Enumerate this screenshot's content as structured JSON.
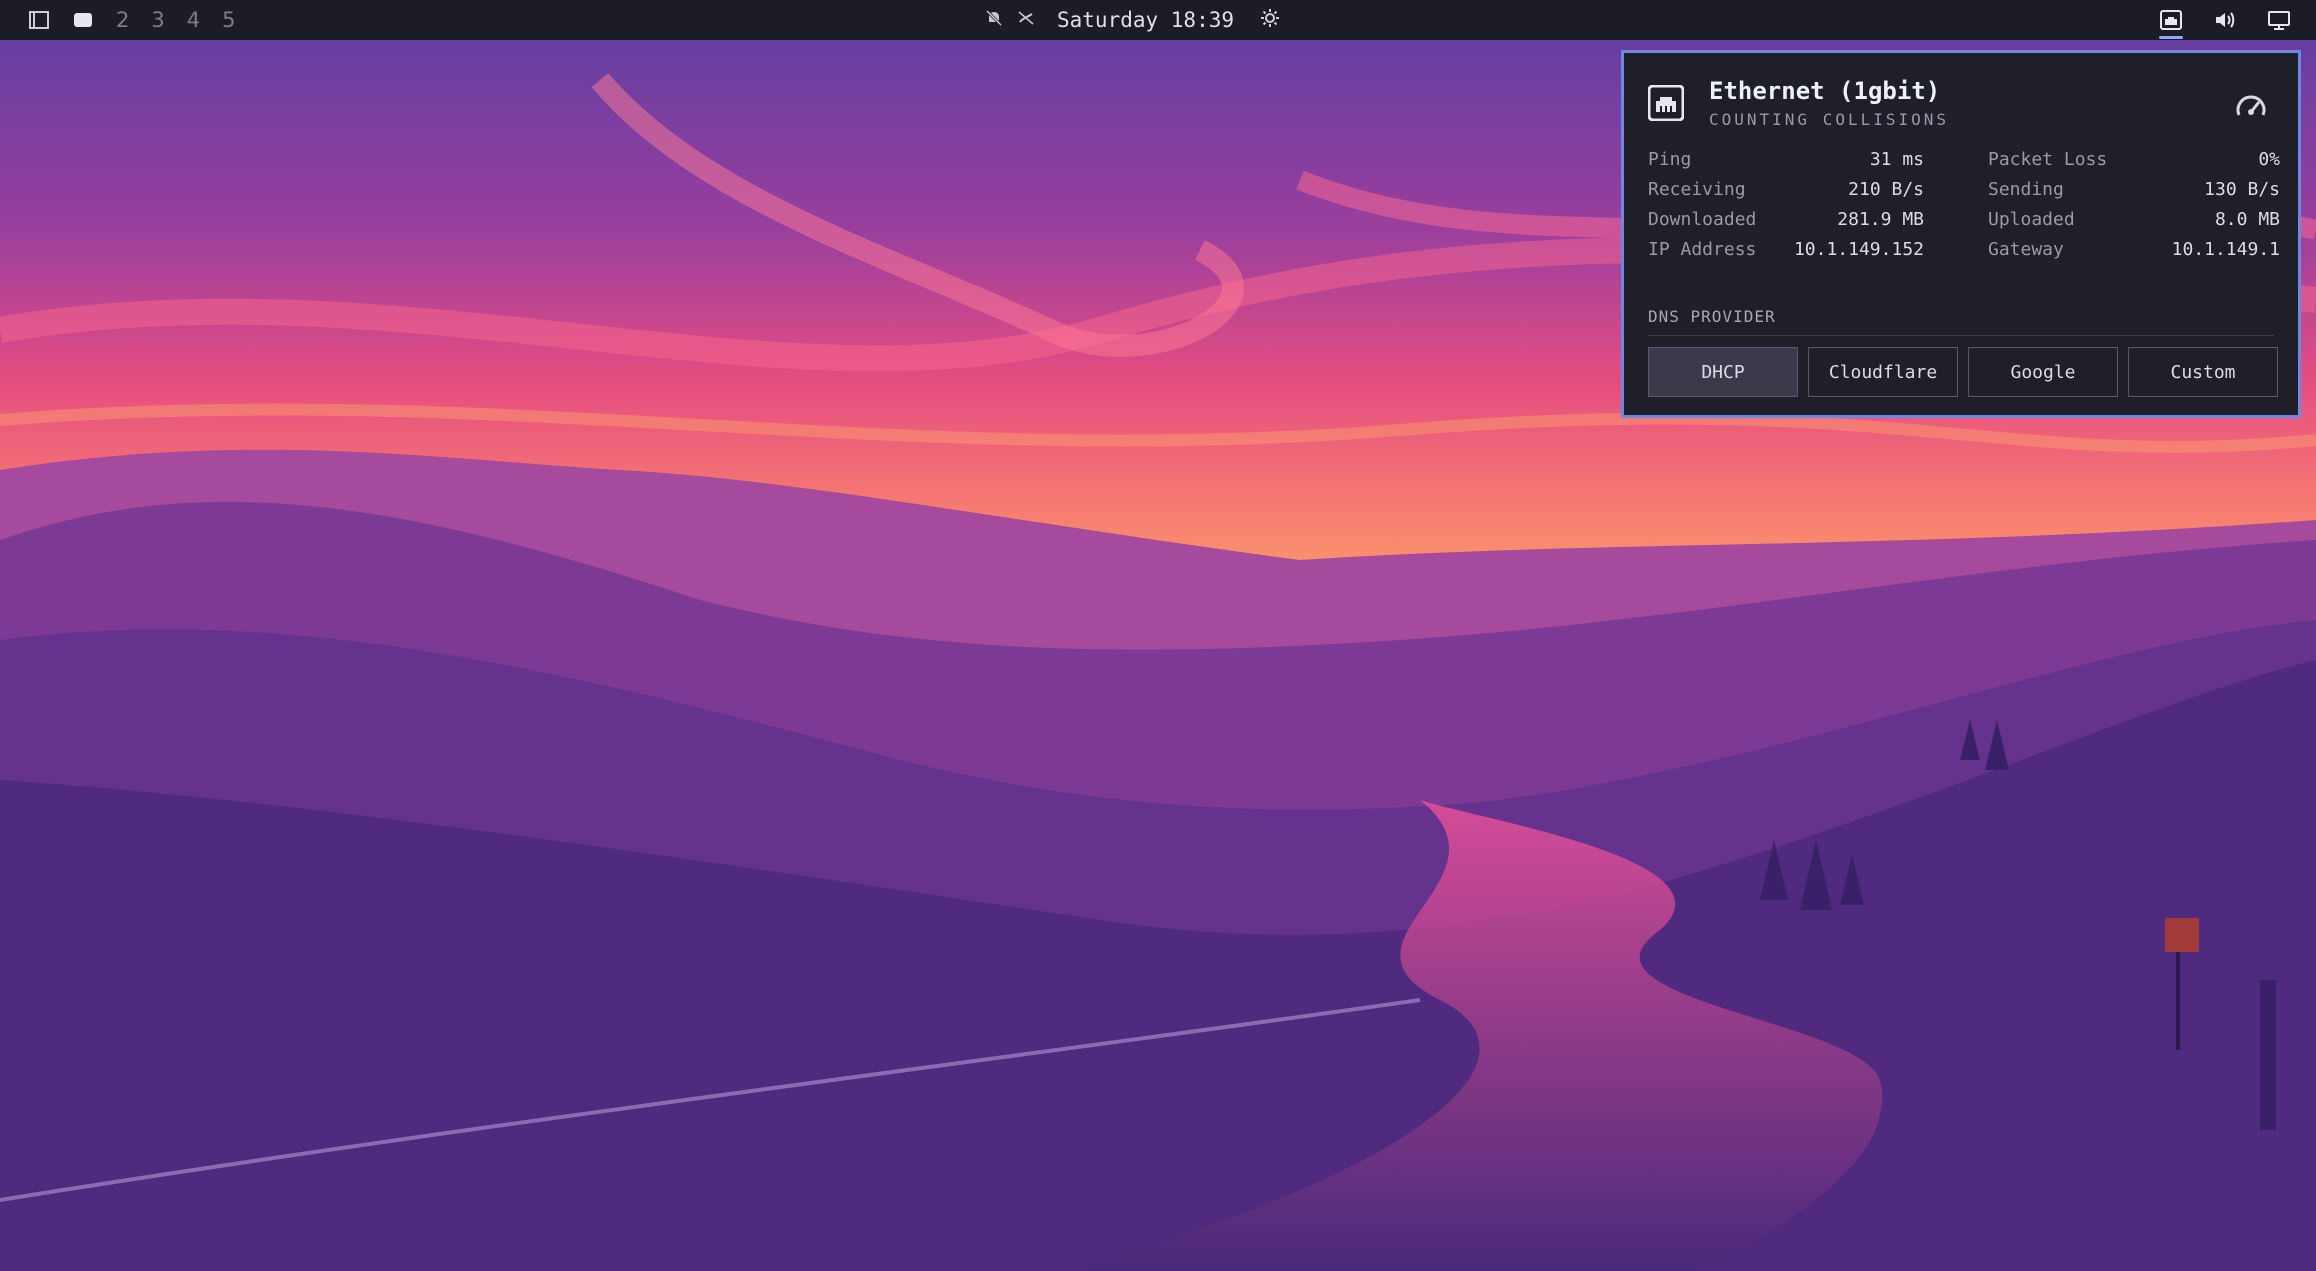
{
  "topbar": {
    "workspaces": [
      "2",
      "3",
      "4",
      "5"
    ],
    "clock": "Saturday 18:39",
    "icons": [
      "window-icon",
      "active-workspace-icon",
      "notifications-off-icon",
      "idle-inhibit-icon",
      "brightness-icon",
      "network-icon",
      "volume-icon",
      "display-icon"
    ]
  },
  "network_popup": {
    "title": "Ethernet (1gbit)",
    "subtitle": "COUNTING COLLISIONS",
    "stats": [
      {
        "label": "Ping",
        "value": "31 ms",
        "label2": "Packet Loss",
        "value2": "0%"
      },
      {
        "label": "Receiving",
        "value": "210 B/s",
        "label2": "Sending",
        "value2": "130 B/s"
      },
      {
        "label": "Downloaded",
        "value": "281.9 MB",
        "label2": "Uploaded",
        "value2": "8.0 MB"
      },
      {
        "label": "IP Address",
        "value": "10.1.149.152",
        "label2": "Gateway",
        "value2": "10.1.149.1"
      }
    ],
    "dns_label": "DNS PROVIDER",
    "dns_options": [
      "DHCP",
      "Cloudflare",
      "Google",
      "Custom"
    ],
    "dns_selected": "DHCP"
  },
  "colors": {
    "accent": "#6f87e0",
    "bar_bg": "#1c1c26",
    "popup_bg": "#1f1f2a"
  }
}
